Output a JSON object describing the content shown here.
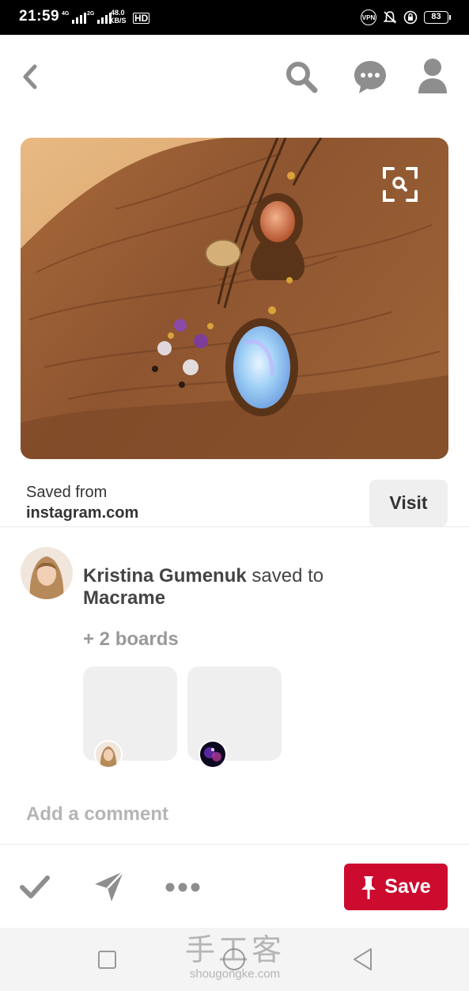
{
  "status_bar": {
    "time": "21:59",
    "signal1_tag": "4G",
    "signal2_tag": "2G",
    "speed_value": "48.0",
    "speed_unit": "KB/S",
    "hd_label": "HD",
    "vpn_label": "VPN",
    "battery": "83"
  },
  "nav": {
    "back_icon": "chevron-left-icon",
    "search_icon": "search-icon",
    "messages_icon": "chat-bubble-icon",
    "profile_icon": "person-icon"
  },
  "pin": {
    "image_description_icon": "lens-icon",
    "saved_from_label": "Saved from",
    "source_domain": "instagram.com",
    "visit_label": "Visit"
  },
  "saver": {
    "name": "Kristina Gumenuk",
    "saved_to_text": "saved to",
    "board_name": "Macrame",
    "more_boards": "+ 2 boards"
  },
  "comment": {
    "placeholder": "Add a comment"
  },
  "actions": {
    "done_icon": "checkmark-icon",
    "send_icon": "send-icon",
    "more_icon": "more-dots-icon",
    "save_label": "Save",
    "save_icon": "pushpin-icon"
  },
  "watermark": {
    "cn": "手工客",
    "en": "shougongke.com"
  },
  "colors": {
    "save_red": "#cc0b2f",
    "icon_gray": "#8e8e8e"
  }
}
